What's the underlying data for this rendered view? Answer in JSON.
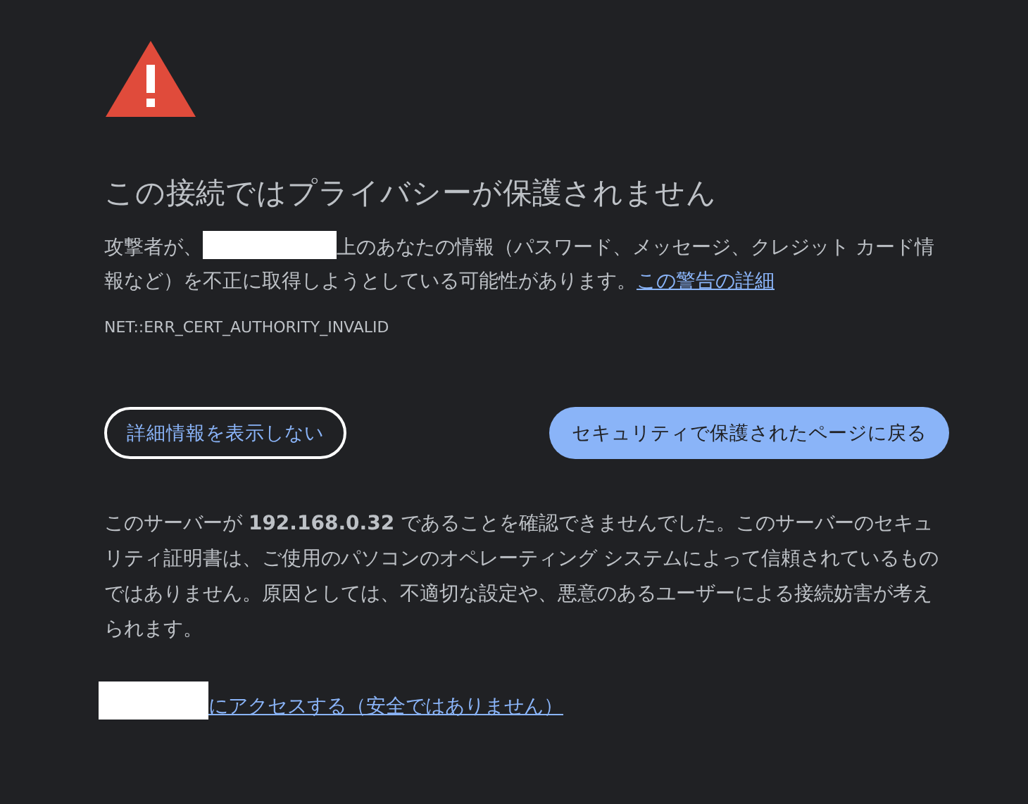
{
  "heading": "この接続ではプライバシーが保護されません",
  "warning": {
    "lead": "攻撃者が、",
    "host_redacted": true,
    "rest": "上のあなたの情報（パスワード、メッセージ、クレジット カード情報など）を不正に取得しようとしている可能性があります。",
    "link": "この警告の詳細"
  },
  "error_code": "NET::ERR_CERT_AUTHORITY_INVALID",
  "buttons": [
    {
      "label": "詳細情報を表示しない",
      "kind": "outline"
    },
    {
      "label": "セキュリティで保護されたページに戻る",
      "kind": "primary"
    }
  ],
  "details": "このサーバーが **192.168.0.32** であることを確認できませんでした。このサーバーのセキュリティ証明書は、ご使用のパソコンのオペレーティング システムによって信頼されているものではありません。原因としては、不適切な設定や、悪意のあるユーザーによる接続妨害が考えられます。",
  "proceed": {
    "host_redacted": true,
    "link": "にアクセスする（安全ではありません）"
  }
}
